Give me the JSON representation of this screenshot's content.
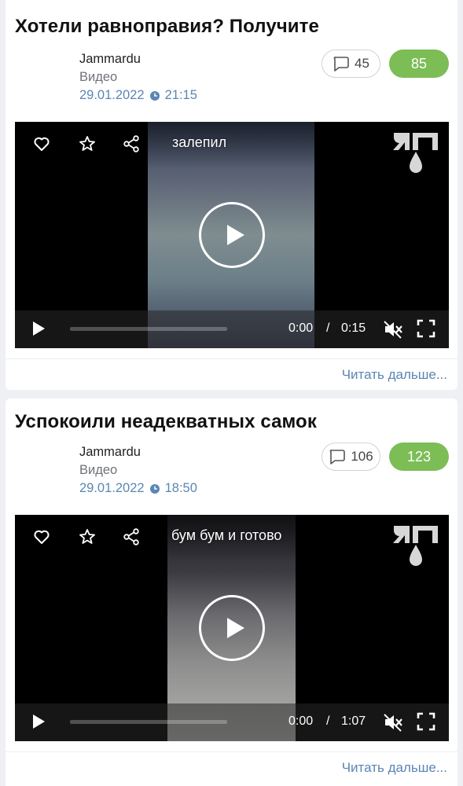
{
  "posts": [
    {
      "title": "Хотели равноправия? Получите",
      "author": "Jammardu",
      "section": "Видео",
      "date": "29.01.2022",
      "time": "21:15",
      "comments": "45",
      "rating": "85",
      "video": {
        "caption": "залепил",
        "current_time": "0:00",
        "separator": "/",
        "duration": "0:15"
      },
      "read_more": "Читать дальше..."
    },
    {
      "title": "Успокоили неадекватных самок",
      "author": "Jammardu",
      "section": "Видео",
      "date": "29.01.2022",
      "time": "18:50",
      "comments": "106",
      "rating": "123",
      "video": {
        "caption": "бум бум и готово",
        "current_time": "0:00",
        "separator": "/",
        "duration": "1:07"
      },
      "read_more": "Читать дальше..."
    }
  ],
  "colors": {
    "rating_bg": "#7cbd56",
    "link": "#5a86b4",
    "page_bg": "#eef0f3"
  },
  "icons": [
    "heart-icon",
    "star-icon",
    "share-icon",
    "play-icon",
    "mute-icon",
    "fullscreen-icon",
    "comment-icon",
    "clock-icon",
    "yap-logo"
  ]
}
